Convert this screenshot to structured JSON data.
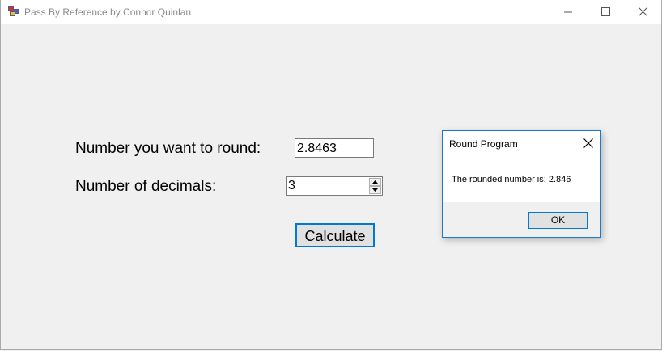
{
  "window": {
    "title": "Pass By Reference by Connor Quinlan",
    "icon": "winforms-app-icon"
  },
  "form": {
    "round_label": "Number you want to round:",
    "round_value": "2.8463",
    "decimals_label": "Number of decimals:",
    "decimals_value": "3",
    "calculate_label": "Calculate"
  },
  "dialog": {
    "title": "Round Program",
    "message": "The rounded number is: 2.846",
    "ok_label": "OK"
  },
  "colors": {
    "accent": "#0078d7",
    "background": "#f0f0f0"
  }
}
